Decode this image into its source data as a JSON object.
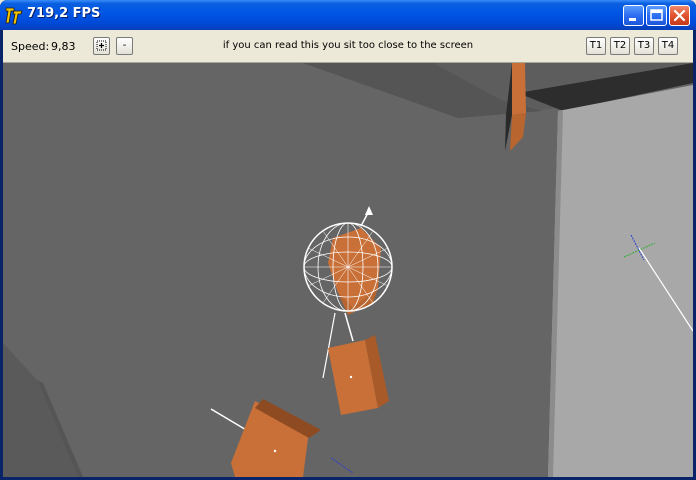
{
  "window": {
    "title": "719,2 FPS"
  },
  "titlebar_buttons": {
    "minimize": "minimize-icon",
    "maximize": "maximize-icon",
    "close": "close-icon"
  },
  "toolbar": {
    "speed_label": "Speed:",
    "speed_value": "9,83",
    "increase_label": "+",
    "decrease_label": "-",
    "notice": "if you can read this you sit too close to the screen",
    "tabs": [
      "T1",
      "T2",
      "T3",
      "T4"
    ]
  },
  "colors": {
    "titlebar": "#0055E5",
    "toolbar_bg": "#ECE9D8",
    "box_orange": "#C87038",
    "wall_gray": "#656565"
  }
}
